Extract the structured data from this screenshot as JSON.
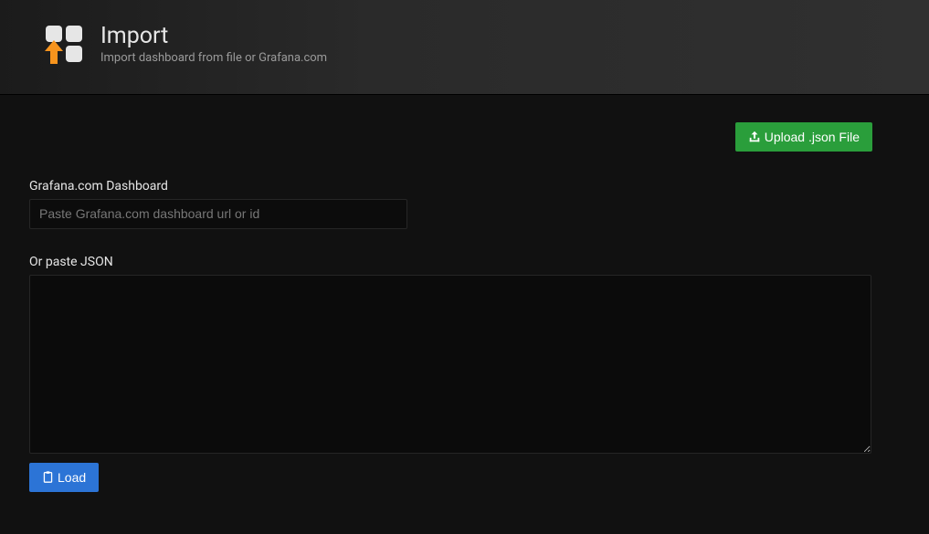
{
  "header": {
    "title": "Import",
    "subtitle": "Import dashboard from file or Grafana.com"
  },
  "upload": {
    "button_label": "Upload .json File"
  },
  "grafana_section": {
    "label": "Grafana.com Dashboard",
    "placeholder": "Paste Grafana.com dashboard url or id",
    "value": ""
  },
  "json_section": {
    "label": "Or paste JSON",
    "value": ""
  },
  "load": {
    "button_label": "Load"
  },
  "colors": {
    "success": "#2a9e3b",
    "primary": "#2c74d6",
    "background": "#111111"
  }
}
